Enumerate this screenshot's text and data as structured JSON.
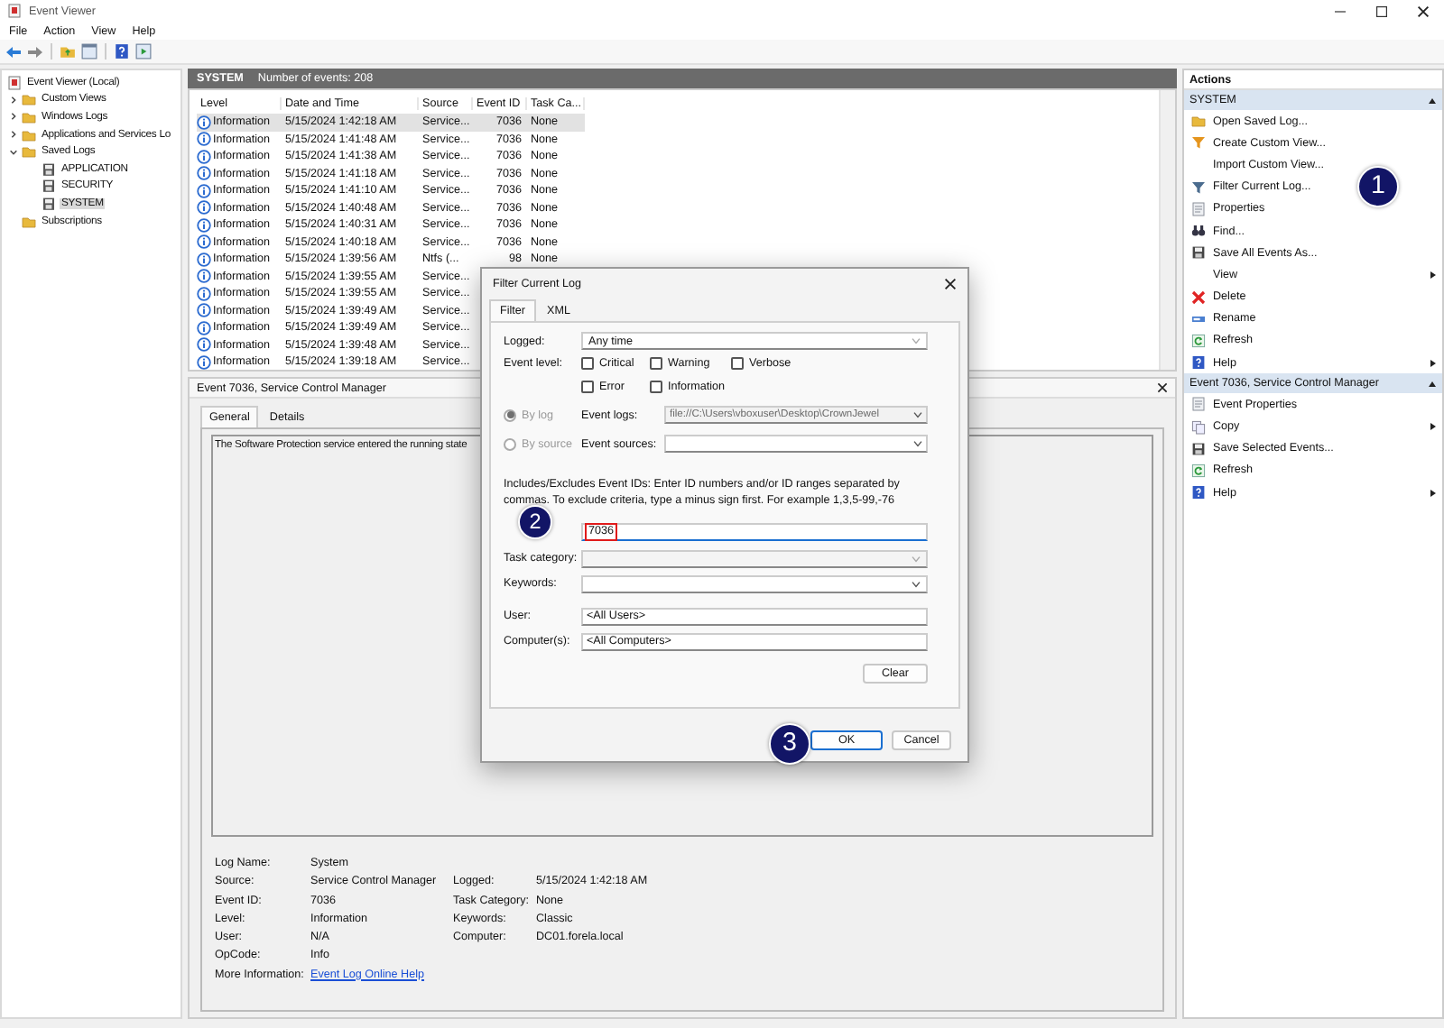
{
  "window": {
    "title": "Event Viewer"
  },
  "menu": [
    {
      "label": "File"
    },
    {
      "label": "Action"
    },
    {
      "label": "View"
    },
    {
      "label": "Help"
    }
  ],
  "tree": [
    {
      "label": "Event Viewer (Local)",
      "kind": "root",
      "selected": false,
      "children": [
        {
          "label": "Custom Views",
          "kind": "folder",
          "selected": false,
          "expanded": false
        },
        {
          "label": "Windows Logs",
          "kind": "folder",
          "selected": false,
          "expanded": false
        },
        {
          "label": "Applications and Services Lo",
          "kind": "folder",
          "selected": false,
          "expanded": false
        },
        {
          "label": "Saved Logs",
          "kind": "folder",
          "selected": false,
          "expanded": true,
          "children": [
            {
              "label": "APPLICATION",
              "kind": "log",
              "selected": false
            },
            {
              "label": "SECURITY",
              "kind": "log",
              "selected": false
            },
            {
              "label": "SYSTEM",
              "kind": "log",
              "selected": true
            }
          ]
        },
        {
          "label": "Subscriptions",
          "kind": "folder",
          "selected": false
        }
      ]
    }
  ],
  "log_header": {
    "name": "SYSTEM",
    "count": "Number of events: 208"
  },
  "events": {
    "columns": [
      "Level",
      "Date and Time",
      "Source",
      "Event ID",
      "Task Ca..."
    ],
    "rows": [
      {
        "level": "Information",
        "date": "5/15/2024 1:42:18 AM",
        "source": "Service...",
        "event_id": "7036",
        "task_category": "None",
        "selected": true
      },
      {
        "level": "Information",
        "date": "5/15/2024 1:41:48 AM",
        "source": "Service...",
        "event_id": "7036",
        "task_category": "None",
        "selected": false
      },
      {
        "level": "Information",
        "date": "5/15/2024 1:41:38 AM",
        "source": "Service...",
        "event_id": "7036",
        "task_category": "None",
        "selected": false
      },
      {
        "level": "Information",
        "date": "5/15/2024 1:41:18 AM",
        "source": "Service...",
        "event_id": "7036",
        "task_category": "None",
        "selected": false
      },
      {
        "level": "Information",
        "date": "5/15/2024 1:41:10 AM",
        "source": "Service...",
        "event_id": "7036",
        "task_category": "None",
        "selected": false
      },
      {
        "level": "Information",
        "date": "5/15/2024 1:40:48 AM",
        "source": "Service...",
        "event_id": "7036",
        "task_category": "None",
        "selected": false
      },
      {
        "level": "Information",
        "date": "5/15/2024 1:40:31 AM",
        "source": "Service...",
        "event_id": "7036",
        "task_category": "None",
        "selected": false
      },
      {
        "level": "Information",
        "date": "5/15/2024 1:40:18 AM",
        "source": "Service...",
        "event_id": "7036",
        "task_category": "None",
        "selected": false
      },
      {
        "level": "Information",
        "date": "5/15/2024 1:39:56 AM",
        "source": "Ntfs (...",
        "event_id": "98",
        "task_category": "None",
        "selected": false
      },
      {
        "level": "Information",
        "date": "5/15/2024 1:39:55 AM",
        "source": "Service...",
        "selected": false
      },
      {
        "level": "Information",
        "date": "5/15/2024 1:39:55 AM",
        "source": "Service...",
        "selected": false
      },
      {
        "level": "Information",
        "date": "5/15/2024 1:39:49 AM",
        "source": "Service...",
        "selected": false
      },
      {
        "level": "Information",
        "date": "5/15/2024 1:39:49 AM",
        "source": "Service...",
        "selected": false
      },
      {
        "level": "Information",
        "date": "5/15/2024 1:39:48 AM",
        "source": "Service...",
        "selected": false
      },
      {
        "level": "Information",
        "date": "5/15/2024 1:39:18 AM",
        "source": "Service...",
        "selected": false
      }
    ]
  },
  "detail": {
    "title": "Event 7036, Service Control Manager",
    "tabs": [
      {
        "label": "General",
        "selected": true
      },
      {
        "label": "Details",
        "selected": false
      }
    ],
    "description": "The Software Protection service entered the running state",
    "property_rows": [
      [
        {
          "label": "Log Name:",
          "value": "System"
        }
      ],
      [
        {
          "label": "Source:",
          "value": "Service Control Manager"
        },
        {
          "label": "Logged:",
          "value": "5/15/2024 1:42:18 AM"
        }
      ],
      [
        {
          "label": "Event ID:",
          "value": "7036"
        },
        {
          "label": "Task Category:",
          "value": "None"
        }
      ],
      [
        {
          "label": "Level:",
          "value": "Information"
        },
        {
          "label": "Keywords:",
          "value": "Classic"
        }
      ],
      [
        {
          "label": "User:",
          "value": "N/A"
        },
        {
          "label": "Computer:",
          "value": "DC01.forela.local"
        }
      ],
      [
        {
          "label": "OpCode:",
          "value": "Info"
        }
      ],
      [
        {
          "label": "More Information:",
          "value": "Event Log Online Help",
          "kind": "link"
        }
      ]
    ]
  },
  "actions": {
    "title": "Actions",
    "sections": [
      {
        "title": "SYSTEM",
        "expanded": true,
        "items": [
          {
            "label": "Open Saved Log...",
            "kind": "open",
            "submenu": false
          },
          {
            "label": "Create Custom View...",
            "kind": "create",
            "submenu": false
          },
          {
            "label": "Import Custom View...",
            "kind": "plain",
            "submenu": false
          },
          {
            "label": "Filter Current Log...",
            "kind": "filter",
            "submenu": false
          },
          {
            "label": "Properties",
            "kind": "properties",
            "submenu": false
          },
          {
            "label": "Find...",
            "kind": "find",
            "submenu": false
          },
          {
            "label": "Save All Events As...",
            "kind": "save",
            "submenu": false
          },
          {
            "label": "View",
            "kind": "plain",
            "submenu": true
          },
          {
            "label": "Delete",
            "kind": "delete",
            "submenu": false
          },
          {
            "label": "Rename",
            "kind": "rename",
            "submenu": false
          },
          {
            "label": "Refresh",
            "kind": "refresh",
            "submenu": false
          },
          {
            "label": "Help",
            "kind": "help",
            "submenu": true
          }
        ]
      },
      {
        "title": "Event 7036, Service Control Manager",
        "expanded": true,
        "items": [
          {
            "label": "Event Properties",
            "kind": "properties",
            "submenu": false
          },
          {
            "label": "Copy",
            "kind": "copy",
            "submenu": true
          },
          {
            "label": "Save Selected Events...",
            "kind": "save",
            "submenu": false
          },
          {
            "label": "Refresh",
            "kind": "refresh",
            "submenu": false
          },
          {
            "label": "Help",
            "kind": "help",
            "submenu": true
          }
        ]
      }
    ]
  },
  "dialog": {
    "title": "Filter Current Log",
    "tabs": [
      {
        "label": "Filter",
        "selected": true
      },
      {
        "label": "XML",
        "selected": false
      }
    ],
    "logged": {
      "label": "Logged:",
      "value": "Any time"
    },
    "event_level": {
      "label": "Event level:",
      "options": [
        {
          "label": "Critical",
          "checked": false
        },
        {
          "label": "Warning",
          "checked": false
        },
        {
          "label": "Verbose",
          "checked": false
        },
        {
          "label": "Error",
          "checked": false
        },
        {
          "label": "Information",
          "checked": false
        }
      ]
    },
    "scope": [
      {
        "label": "By log",
        "selected": true,
        "disabled": true,
        "field_label": "Event logs:",
        "value": "file://C:\\Users\\vboxuser\\Desktop\\CrownJewel"
      },
      {
        "label": "By source",
        "selected": false,
        "disabled": true,
        "field_label": "Event sources:"
      }
    ],
    "event_ids": {
      "description": "Includes/Excludes Event IDs: Enter ID numbers and/or ID ranges separated by commas. To exclude criteria, type a minus sign first. For example 1,3,5-99,-76",
      "value": "7036",
      "highlighted": true
    },
    "task_category": {
      "label": "Task category:",
      "disabled": true
    },
    "keywords": {
      "label": "Keywords:",
      "disabled": false
    },
    "user": {
      "label": "User:",
      "value": "<All Users>"
    },
    "computers": {
      "label": "Computer(s):",
      "value": "<All Computers>"
    },
    "clear_button": "Clear",
    "buttons": [
      {
        "label": "OK",
        "default": true
      },
      {
        "label": "Cancel",
        "default": false
      }
    ]
  },
  "annotations": [
    {
      "label": "1"
    },
    {
      "label": "2"
    },
    {
      "label": "3"
    }
  ]
}
